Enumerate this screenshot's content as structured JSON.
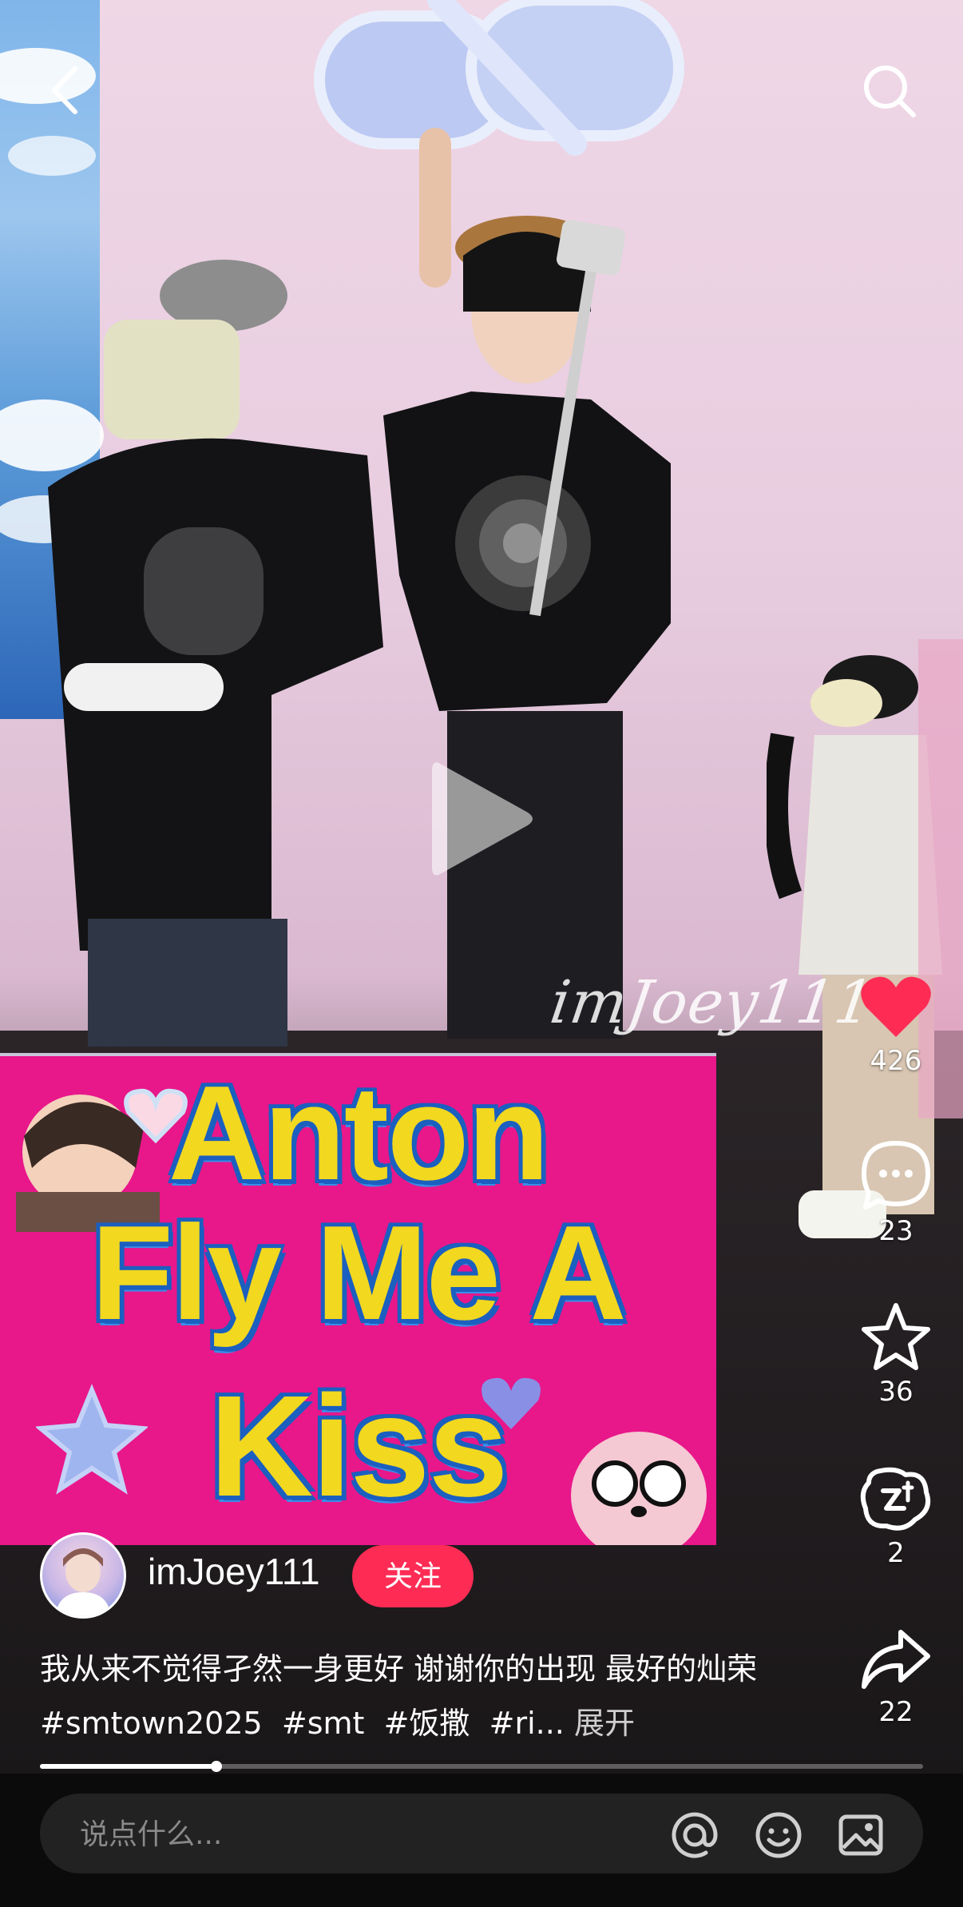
{
  "video": {
    "watermark": "imJoey111",
    "sign": {
      "line1": "Anton",
      "line2": "Fly Me A",
      "line3": "Kiss"
    }
  },
  "top_bar": {
    "back_icon": "chevron-left-icon",
    "search_icon": "search-icon"
  },
  "actions": {
    "like": {
      "icon": "heart-icon",
      "count": "426",
      "color": "#fe2c55"
    },
    "comment": {
      "icon": "comment-icon",
      "count": "23"
    },
    "favorite": {
      "icon": "star-icon",
      "count": "36"
    },
    "remix": {
      "icon": "remix-icon",
      "count": "2"
    },
    "share": {
      "icon": "share-icon",
      "count": "22"
    }
  },
  "author": {
    "name": "imJoey111",
    "follow_label": "关注"
  },
  "caption": {
    "text": "我从来不觉得孑然一身更好 谢谢你的出现 最好的灿荣",
    "hashtags": [
      "#smtown2025",
      "#smt",
      "#饭撒",
      "#ri..."
    ],
    "more_label": "展开"
  },
  "progress": {
    "played_fraction": 0.2
  },
  "comment_bar": {
    "placeholder": "说点什么...",
    "icons": [
      "at-icon",
      "emoji-icon",
      "image-icon"
    ]
  }
}
